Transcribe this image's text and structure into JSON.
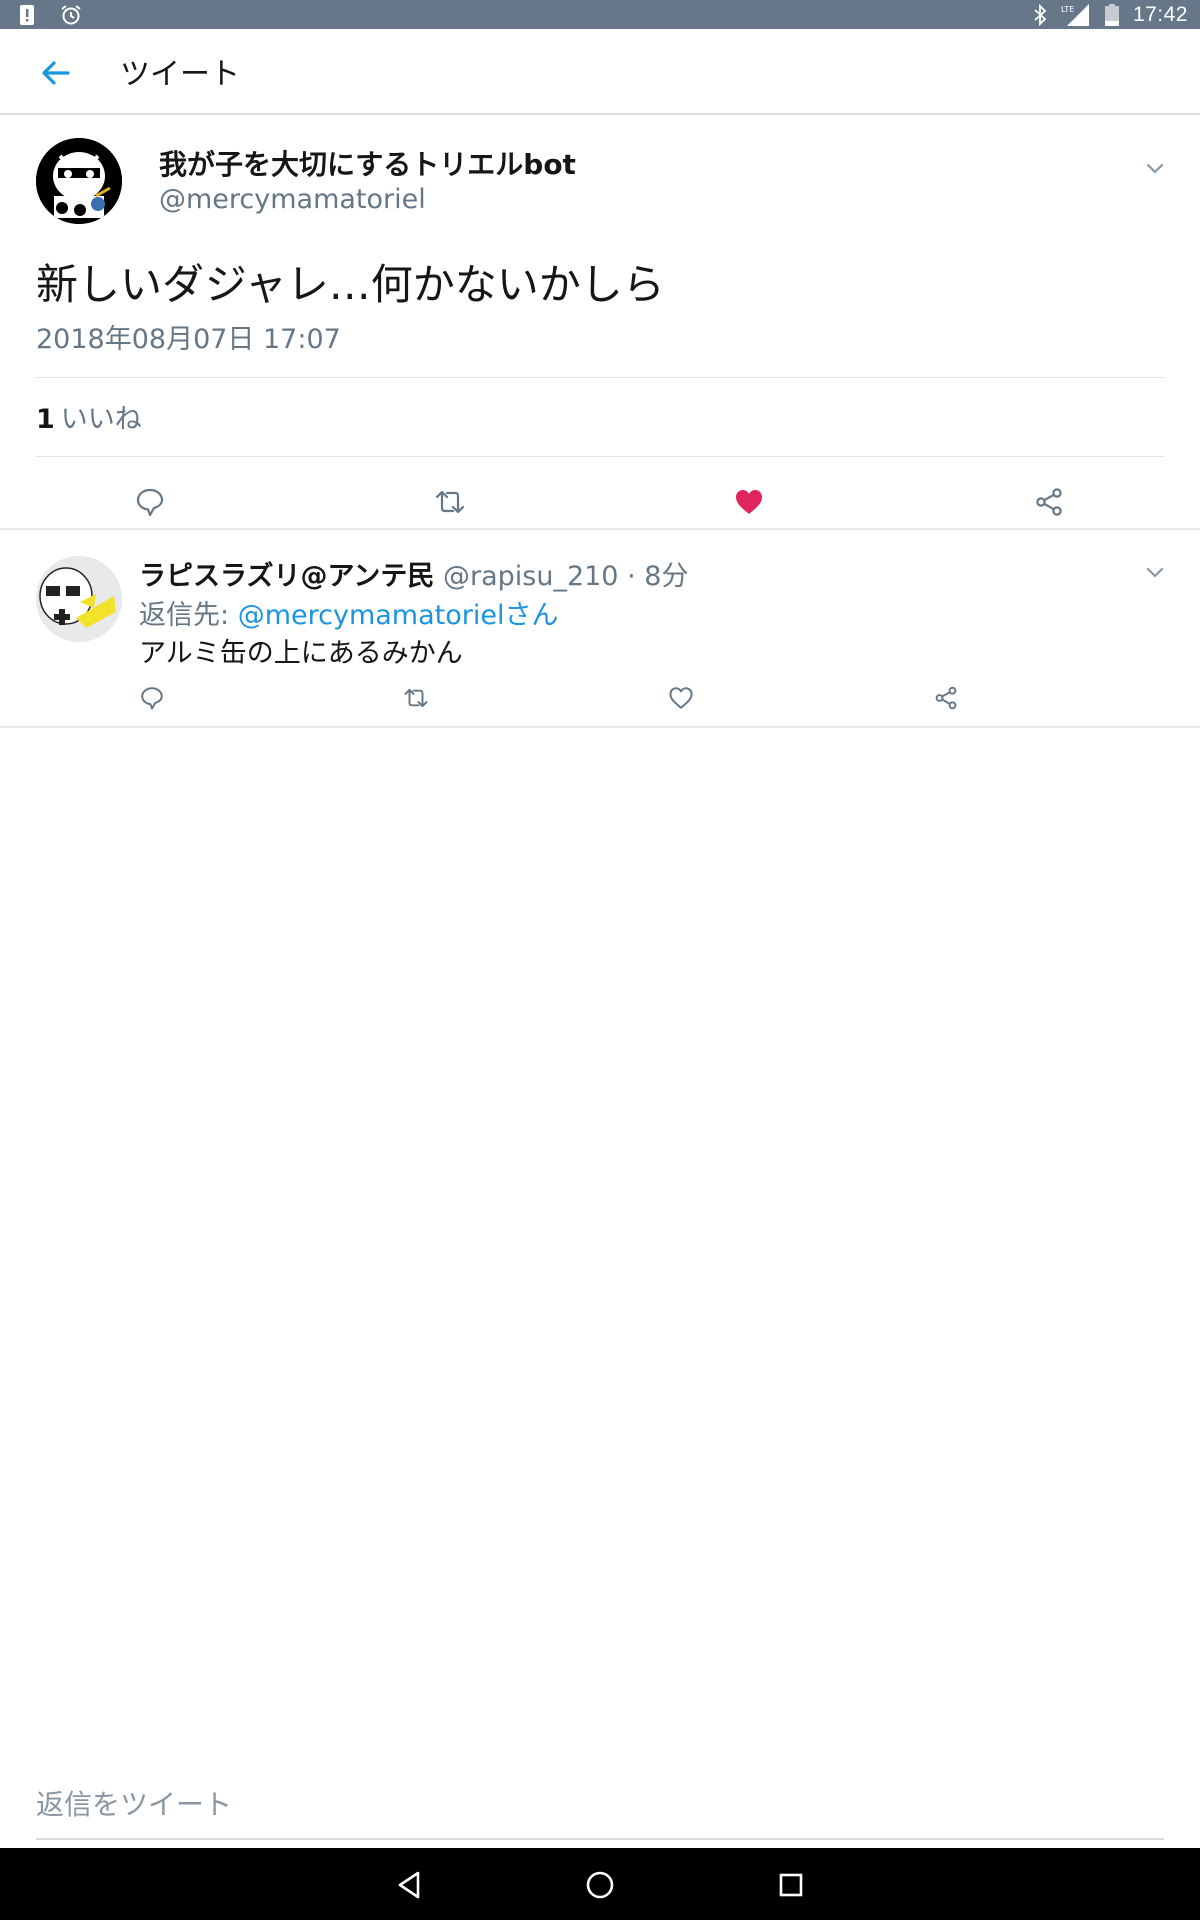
{
  "status_bar": {
    "time": "17:42",
    "network_label": "LTE",
    "icons": [
      "alert-icon",
      "alarm-icon",
      "bluetooth-icon",
      "signal-icon",
      "battery-icon"
    ]
  },
  "app_bar": {
    "title": "ツイート",
    "back_icon": "arrow-left-icon"
  },
  "main_tweet": {
    "author_name": "我が子を大切にするトリエルbot",
    "author_handle": "@mercymamatoriel",
    "text": "新しいダジャレ…何かないかしら",
    "timestamp": "2018年08月07日 17:07",
    "like_count": "1",
    "like_label": "いいね",
    "liked": true,
    "actions": [
      "reply-icon",
      "retweet-icon",
      "like-icon",
      "share-icon"
    ]
  },
  "reply": {
    "author_name": "ラピスラズリ@アンテ民",
    "author_handle": "@rapisu_210",
    "separator": "·",
    "time_ago": "8分",
    "reply_to_label": "返信先:",
    "reply_to_user": "@mercymamatorielさん",
    "text": "アルミ缶の上にあるみかん",
    "actions": [
      "reply-icon",
      "retweet-icon",
      "like-icon",
      "share-icon"
    ]
  },
  "composer": {
    "placeholder": "返信をツイート"
  },
  "nav_bar": {
    "buttons": [
      "back-triangle-icon",
      "home-circle-icon",
      "recents-square-icon"
    ]
  },
  "colors": {
    "status_bar": "#66778a",
    "link_blue": "#1b95e0",
    "like_red": "#e0245e",
    "secondary_text": "#657786",
    "icon_gray": "#657786"
  }
}
